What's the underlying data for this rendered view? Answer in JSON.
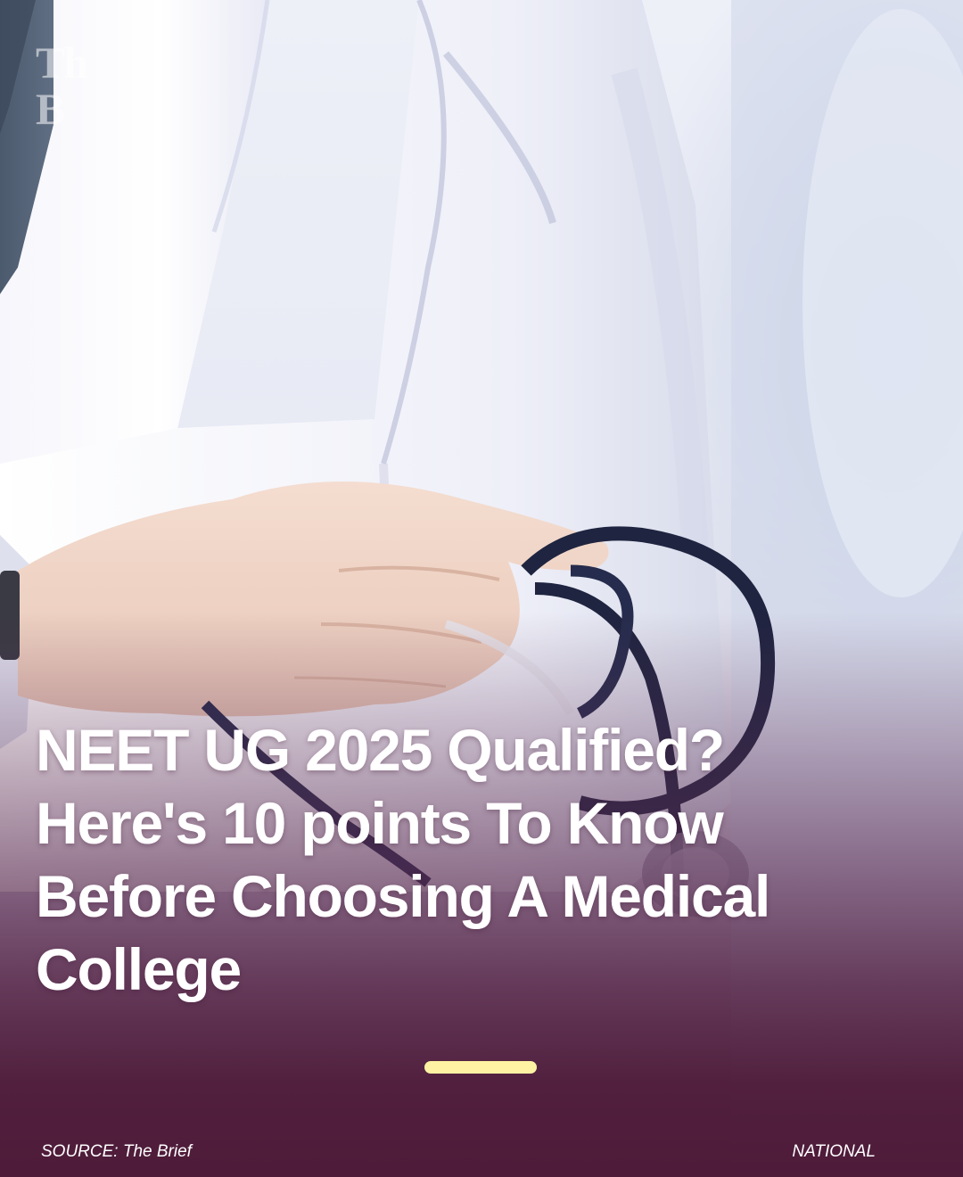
{
  "logo": {
    "line1": "Th",
    "line2": "B"
  },
  "headline": {
    "line1": "NEET UG 2025 Qualified?",
    "line2": "Here's 10 points To Know",
    "line3": "Before Choosing A Medical",
    "line4": "College"
  },
  "footer": {
    "source": "SOURCE: The Brief",
    "category": "NATIONAL"
  },
  "colors": {
    "background": "#4e1b39",
    "divider": "#fff3a3",
    "text": "#ffffff"
  },
  "image": {
    "subject": "doctor-in-white-coat-holding-stethoscope"
  }
}
